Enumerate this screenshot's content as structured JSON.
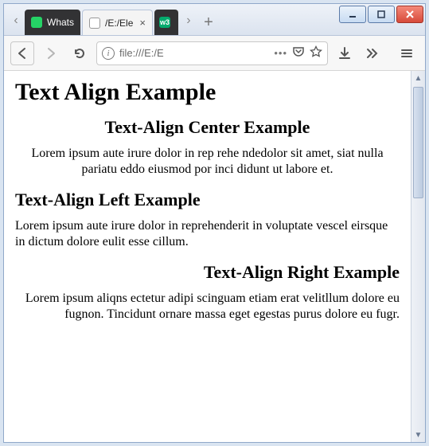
{
  "window": {
    "min_tooltip": "Minimize",
    "max_tooltip": "Maximize",
    "close_tooltip": "Close"
  },
  "tabs": {
    "prev_label": "‹",
    "items": [
      {
        "label": "Whats"
      },
      {
        "label": "/E:/Ele"
      }
    ],
    "w3_label": "w3",
    "next_label": "›",
    "new_label": "+"
  },
  "toolbar": {
    "info_char": "i",
    "url_text": "file:///E:/E",
    "more_label": "•••"
  },
  "page": {
    "h1": "Text Align Example",
    "sec1": {
      "heading": "Text-Align Center Example",
      "body": "Lorem ipsum aute irure dolor in rep rehe ndedolor sit amet, siat nulla pariatu eddo eiusmod por inci didunt ut labore et."
    },
    "sec2": {
      "heading": "Text-Align Left Example",
      "body": "Lorem ipsum aute irure dolor in reprehenderit in voluptate vescel eirsque in dictum dolore eulit esse cillum."
    },
    "sec3": {
      "heading": "Text-Align Right Example",
      "body": "Lorem ipsum aliqns ectetur adipi scinguam etiam erat velitllum dolore eu fugnon. Tincidunt ornare massa eget egestas purus dolore eu fugr."
    }
  }
}
